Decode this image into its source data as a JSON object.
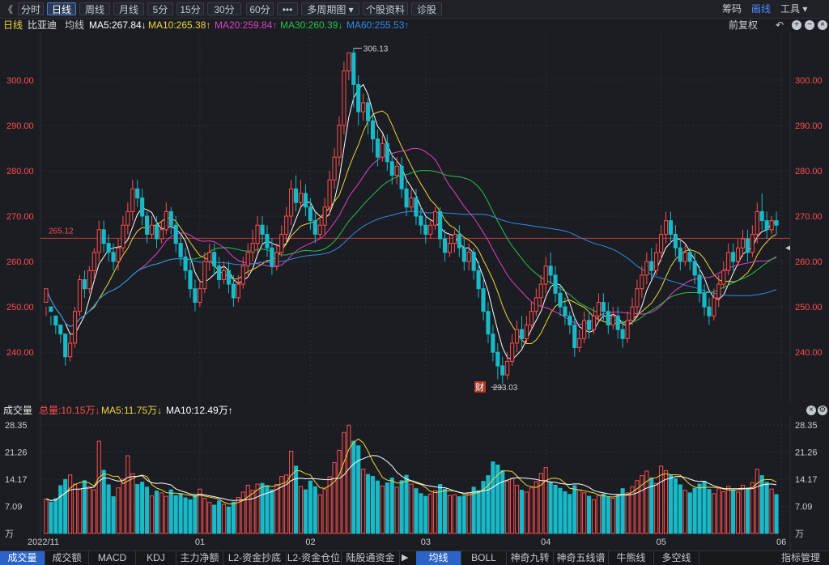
{
  "toolbar": {
    "back": "《",
    "buttons": [
      "分时",
      "日线",
      "周线",
      "月线",
      "5分",
      "15分",
      "30分",
      "60分",
      "•••",
      "多周期图 ▾",
      "个股资料",
      "诊股"
    ],
    "active_index": 1,
    "right": [
      "筹码",
      "画线",
      "工具 ▾"
    ],
    "right_active": 1
  },
  "info": {
    "period": "日线",
    "stock": "比亚迪",
    "avg_label": "均线",
    "ma5": "MA5:267.84↓",
    "ma10": "MA10:265.38↑",
    "ma20": "MA20:259.84↑",
    "ma30": "MA30:260.39↓",
    "ma60": "MA60:255.53↑",
    "restore": "前复权"
  },
  "colors": {
    "up": "#ff4d4d",
    "down": "#19b9c8",
    "ma5": "#ffffff",
    "ma10": "#f0d53a",
    "ma20": "#e040c8",
    "ma30": "#27c24c",
    "ma60": "#2f8ae6",
    "grid": "#2d3038",
    "ref": "#c03b3b"
  },
  "volume_info": {
    "title": "成交量",
    "total": "总量:10.15万↓",
    "ma5": "MA5:11.75万↓",
    "ma10": "MA10:12.49万↑"
  },
  "chart_data": {
    "type": "candlestick",
    "price_ticks": [
      "300.00",
      "290.00",
      "280.00",
      "270.00",
      "260.00",
      "250.00",
      "240.00"
    ],
    "ylim": [
      232,
      308
    ],
    "ref_line": {
      "value": 265.12,
      "label": "265.12"
    },
    "annotations": [
      {
        "label": "306.13",
        "value": 306.13
      },
      {
        "label": "233.03",
        "value": 233.03
      }
    ],
    "event_badge": "财",
    "x_labels": [
      "2022/11",
      "01",
      "02",
      "03",
      "04",
      "05",
      "06"
    ],
    "volume_ticks": [
      "28.35",
      "21.26",
      "14.17",
      "7.09",
      "万"
    ],
    "volume_ylim": [
      0,
      28.35
    ],
    "candles": [
      [
        251,
        254,
        248,
        250,
        9.0
      ],
      [
        250,
        249,
        246,
        248,
        8.2
      ],
      [
        248,
        246,
        244,
        247,
        9.1
      ],
      [
        246,
        244,
        242,
        245,
        12.5
      ],
      [
        244,
        239,
        237,
        243,
        14.1
      ],
      [
        239,
        242,
        238,
        244,
        15.3
      ],
      [
        242,
        249,
        241,
        250,
        12.9
      ],
      [
        249,
        256,
        248,
        257,
        11.6
      ],
      [
        256,
        254,
        252,
        258,
        13.8
      ],
      [
        254,
        258,
        253,
        259,
        12.2
      ],
      [
        258,
        262,
        256,
        263,
        11.4
      ],
      [
        262,
        267,
        260,
        269,
        24.1
      ],
      [
        267,
        264,
        262,
        269,
        16.5
      ],
      [
        264,
        262,
        260,
        266,
        12.7
      ],
      [
        262,
        260,
        258,
        264,
        9.6
      ],
      [
        260,
        263,
        258,
        265,
        11.9
      ],
      [
        263,
        268,
        262,
        270,
        14.2
      ],
      [
        268,
        271,
        266,
        273,
        20.3
      ],
      [
        271,
        276,
        269,
        278,
        15.6
      ],
      [
        276,
        274,
        272,
        278,
        12.8
      ],
      [
        274,
        270,
        268,
        276,
        13.4
      ],
      [
        270,
        266,
        264,
        271,
        12.1
      ],
      [
        266,
        268,
        265,
        270,
        9.8
      ],
      [
        268,
        265,
        263,
        270,
        11.1
      ],
      [
        265,
        267,
        264,
        269,
        10.6
      ],
      [
        267,
        271,
        266,
        273,
        9.7
      ],
      [
        271,
        268,
        266,
        272,
        11.4
      ],
      [
        268,
        264,
        262,
        270,
        9.9
      ],
      [
        264,
        261,
        259,
        266,
        10.4
      ],
      [
        261,
        258,
        256,
        263,
        9.3
      ],
      [
        258,
        254,
        252,
        260,
        8.8
      ],
      [
        254,
        251,
        249,
        256,
        9.9
      ],
      [
        251,
        254,
        250,
        256,
        11.6
      ],
      [
        254,
        260,
        253,
        262,
        9.2
      ],
      [
        260,
        262,
        258,
        264,
        8.1
      ],
      [
        262,
        259,
        257,
        264,
        7.4
      ],
      [
        259,
        256,
        254,
        261,
        8.5
      ],
      [
        256,
        258,
        255,
        260,
        7.6
      ],
      [
        258,
        255,
        253,
        260,
        6.9
      ],
      [
        255,
        252,
        250,
        257,
        8.2
      ],
      [
        252,
        255,
        251,
        257,
        9.4
      ],
      [
        255,
        259,
        254,
        261,
        10.8
      ],
      [
        259,
        262,
        257,
        264,
        12.6
      ],
      [
        262,
        264,
        260,
        267,
        11.3
      ],
      [
        264,
        268,
        262,
        270,
        12.9
      ],
      [
        268,
        266,
        264,
        270,
        13.1
      ],
      [
        266,
        263,
        261,
        268,
        12.5
      ],
      [
        263,
        259,
        257,
        265,
        11.4
      ],
      [
        259,
        262,
        258,
        264,
        12.8
      ],
      [
        262,
        266,
        261,
        268,
        14.9
      ],
      [
        266,
        270,
        264,
        272,
        15.3
      ],
      [
        270,
        276,
        268,
        278,
        21.5
      ],
      [
        276,
        273,
        271,
        279,
        17.6
      ],
      [
        273,
        275,
        272,
        278,
        12.3
      ],
      [
        275,
        272,
        270,
        277,
        11.4
      ],
      [
        272,
        269,
        267,
        274,
        13.7
      ],
      [
        269,
        266,
        264,
        271,
        12.2
      ],
      [
        266,
        268,
        265,
        270,
        10.1
      ],
      [
        268,
        272,
        266,
        274,
        11.6
      ],
      [
        272,
        278,
        270,
        280,
        14.8
      ],
      [
        278,
        283,
        276,
        285,
        18.5
      ],
      [
        283,
        290,
        281,
        292,
        21.7
      ],
      [
        290,
        302,
        288,
        304,
        26.4
      ],
      [
        302,
        306,
        300,
        306.13,
        28.3
      ],
      [
        306,
        299,
        294,
        307,
        24.1
      ],
      [
        299,
        293,
        290,
        301,
        22.9
      ],
      [
        293,
        295,
        291,
        297,
        16.8
      ],
      [
        295,
        291,
        288,
        296,
        15.4
      ],
      [
        291,
        287,
        284,
        293,
        14.9
      ],
      [
        287,
        283,
        281,
        289,
        13.7
      ],
      [
        283,
        286,
        282,
        288,
        12.4
      ],
      [
        286,
        282,
        280,
        288,
        13.2
      ],
      [
        282,
        279,
        277,
        284,
        14.5
      ],
      [
        279,
        281,
        277,
        283,
        12.1
      ],
      [
        281,
        276,
        274,
        283,
        13.8
      ],
      [
        276,
        272,
        270,
        278,
        15.2
      ],
      [
        272,
        274,
        271,
        276,
        12.9
      ],
      [
        274,
        270,
        268,
        276,
        11.7
      ],
      [
        270,
        268,
        266,
        272,
        10.4
      ],
      [
        268,
        266,
        264,
        270,
        9.7
      ],
      [
        266,
        268,
        265,
        269,
        10.3
      ],
      [
        268,
        271,
        267,
        272,
        11.2
      ],
      [
        271,
        265,
        263,
        272,
        12.8
      ],
      [
        265,
        262,
        260,
        267,
        11.6
      ],
      [
        262,
        264,
        261,
        266,
        9.9
      ],
      [
        264,
        266,
        262,
        267,
        10.1
      ],
      [
        266,
        263,
        261,
        268,
        9.6
      ],
      [
        263,
        260,
        258,
        265,
        9.8
      ],
      [
        260,
        262,
        258,
        264,
        10.7
      ],
      [
        262,
        258,
        256,
        263,
        12.1
      ],
      [
        258,
        254,
        252,
        260,
        11.2
      ],
      [
        254,
        249,
        247,
        256,
        13.6
      ],
      [
        249,
        244,
        242,
        251,
        15.1
      ],
      [
        244,
        240,
        238,
        246,
        18.7
      ],
      [
        240,
        237,
        234,
        242,
        17.9
      ],
      [
        237,
        235,
        233.03,
        239,
        16.4
      ],
      [
        235,
        238,
        234,
        240,
        13.7
      ],
      [
        238,
        242,
        237,
        244,
        14.4
      ],
      [
        242,
        245,
        240,
        247,
        12.6
      ],
      [
        245,
        243,
        241,
        248,
        11.3
      ],
      [
        243,
        246,
        242,
        248,
        10.8
      ],
      [
        246,
        249,
        245,
        251,
        11.9
      ],
      [
        249,
        252,
        248,
        254,
        13.5
      ],
      [
        252,
        255,
        250,
        257,
        15.7
      ],
      [
        255,
        259,
        253,
        261,
        17.2
      ],
      [
        259,
        257,
        255,
        262,
        13.4
      ],
      [
        257,
        253,
        251,
        259,
        12.6
      ],
      [
        253,
        250,
        248,
        255,
        11.8
      ],
      [
        250,
        248,
        246,
        252,
        10.9
      ],
      [
        248,
        246,
        244,
        249,
        10.2
      ],
      [
        246,
        241,
        239,
        248,
        12.5
      ],
      [
        241,
        243,
        240,
        245,
        11.4
      ],
      [
        243,
        247,
        242,
        249,
        10.6
      ],
      [
        247,
        245,
        243,
        249,
        9.7
      ],
      [
        245,
        248,
        244,
        250,
        8.8
      ],
      [
        248,
        251,
        247,
        253,
        9.9
      ],
      [
        251,
        249,
        247,
        253,
        10.3
      ],
      [
        249,
        246,
        244,
        251,
        9.4
      ],
      [
        246,
        248,
        245,
        250,
        9.2
      ],
      [
        248,
        245,
        243,
        250,
        10.1
      ],
      [
        245,
        243,
        241,
        247,
        11.7
      ],
      [
        243,
        247,
        242,
        249,
        10.6
      ],
      [
        247,
        250,
        246,
        252,
        12.2
      ],
      [
        250,
        254,
        248,
        256,
        13.8
      ],
      [
        254,
        257,
        252,
        259,
        15.1
      ],
      [
        257,
        260,
        255,
        262,
        16.3
      ],
      [
        260,
        258,
        256,
        263,
        14.5
      ],
      [
        258,
        262,
        257,
        264,
        13.1
      ],
      [
        262,
        266,
        260,
        268,
        17.6
      ],
      [
        266,
        269,
        264,
        271,
        16.4
      ],
      [
        269,
        266,
        264,
        271,
        15.2
      ],
      [
        266,
        263,
        261,
        268,
        14.3
      ],
      [
        263,
        260,
        258,
        265,
        12.7
      ],
      [
        260,
        262,
        259,
        264,
        11.3
      ],
      [
        262,
        260,
        258,
        263,
        10.6
      ],
      [
        260,
        257,
        255,
        262,
        11.8
      ],
      [
        257,
        253,
        251,
        259,
        12.9
      ],
      [
        253,
        250,
        248,
        255,
        13.6
      ],
      [
        250,
        248,
        246,
        252,
        11.5
      ],
      [
        248,
        252,
        247,
        254,
        10.4
      ],
      [
        252,
        255,
        250,
        257,
        11.7
      ],
      [
        255,
        258,
        254,
        260,
        10.9
      ],
      [
        258,
        262,
        257,
        264,
        12.3
      ],
      [
        262,
        260,
        258,
        264,
        11.4
      ],
      [
        260,
        263,
        259,
        265,
        10.8
      ],
      [
        263,
        265,
        261,
        267,
        12.6
      ],
      [
        265,
        262,
        260,
        267,
        11.9
      ],
      [
        262,
        266,
        261,
        268,
        13.3
      ],
      [
        266,
        271,
        264,
        273,
        16.8
      ],
      [
        271,
        269,
        267,
        275,
        15.1
      ],
      [
        269,
        267,
        265,
        271,
        13.4
      ],
      [
        267,
        269,
        266,
        270,
        11.6
      ],
      [
        269,
        268,
        266,
        271,
        10.15
      ]
    ]
  },
  "bottom_tabs": {
    "left": [
      "成交量",
      "成交额",
      "MACD",
      "KDJ",
      "主力净额",
      "L2-资金抄底",
      "L2-资金仓位",
      "陆股通资金"
    ],
    "left_active": 0,
    "arrow": "▶",
    "right": [
      "均线",
      "BOLL",
      "神奇九转",
      "神奇五线谱",
      "牛熊线",
      "多空线"
    ],
    "right_active": 0,
    "manager": "指标管理"
  }
}
